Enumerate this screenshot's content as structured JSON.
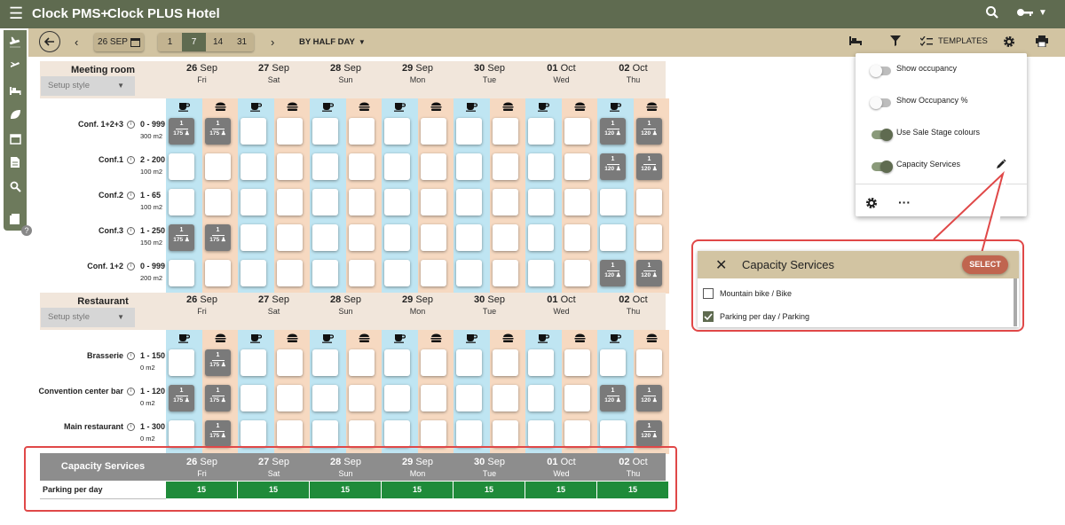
{
  "app": {
    "name": "Clock PMS+",
    "hotel": "Clock PLUS Hotel"
  },
  "toolbar": {
    "date": "26 SEP",
    "ranges": [
      "1",
      "7",
      "14",
      "31"
    ],
    "selected_range": "7",
    "view": "BY HALF DAY",
    "templates": "TEMPLATES"
  },
  "days": [
    {
      "d": "26",
      "m": "Sep",
      "w": "Fri"
    },
    {
      "d": "27",
      "m": "Sep",
      "w": "Sat"
    },
    {
      "d": "28",
      "m": "Sep",
      "w": "Sun"
    },
    {
      "d": "29",
      "m": "Sep",
      "w": "Mon"
    },
    {
      "d": "30",
      "m": "Sep",
      "w": "Tue"
    },
    {
      "d": "01",
      "m": "Oct",
      "w": "Wed"
    },
    {
      "d": "02",
      "m": "Oct",
      "w": "Thu"
    }
  ],
  "sections": [
    {
      "title": "Meeting room",
      "setup": "Setup style",
      "rows": [
        {
          "name": "Conf. 1+2+3",
          "cap": "0 - 999",
          "m2": "300 m2",
          "booked": [
            0,
            1,
            12,
            13
          ]
        },
        {
          "name": "Conf.1",
          "cap": "2 - 200",
          "m2": "100 m2",
          "booked": [
            12,
            13
          ]
        },
        {
          "name": "Conf.2",
          "cap": "1 - 65",
          "m2": "100 m2",
          "booked": []
        },
        {
          "name": "Conf.3",
          "cap": "1 - 250",
          "m2": "150 m2",
          "booked": [
            0,
            1
          ]
        },
        {
          "name": "Conf. 1+2",
          "cap": "0 - 999",
          "m2": "200 m2",
          "booked": [
            12,
            13
          ]
        }
      ]
    },
    {
      "title": "Restaurant",
      "setup": "Setup style",
      "rows": [
        {
          "name": "Brasserie",
          "cap": "1 - 150",
          "m2": "0 m2",
          "booked": [
            1
          ]
        },
        {
          "name": "Convention center bar",
          "cap": "1 - 120",
          "m2": "0 m2",
          "booked": [
            0,
            1,
            12,
            13
          ]
        },
        {
          "name": "Main restaurant",
          "cap": "1 - 300",
          "m2": "0 m2",
          "booked": [
            1,
            13
          ]
        }
      ]
    }
  ],
  "cell_values": {
    "top": "1",
    "dash": "—",
    "large": "175 ♟",
    "small": "120 ♟"
  },
  "capacity": {
    "title": "Capacity Services",
    "row_label": "Parking per day",
    "values": [
      "15",
      "15",
      "15",
      "15",
      "15",
      "15",
      "15"
    ]
  },
  "dropdown": {
    "options": [
      {
        "label": "Show occupancy",
        "on": false
      },
      {
        "label": "Show Occupancy %",
        "on": false
      },
      {
        "label": "Use Sale Stage colours",
        "on": true
      },
      {
        "label": "Capacity Services",
        "on": true
      }
    ]
  },
  "popup": {
    "title": "Capacity Services",
    "button": "SELECT",
    "items": [
      {
        "label": "Mountain bike / Bike",
        "checked": false
      },
      {
        "label": "Parking per day / Parking",
        "checked": true
      }
    ]
  },
  "colors": {
    "primary": "#5f6b50",
    "tan": "#d2c4a2",
    "blue": "#bfe5f2",
    "peach": "#f6d9c1",
    "green": "#1f8b3a",
    "red": "#e04848"
  }
}
